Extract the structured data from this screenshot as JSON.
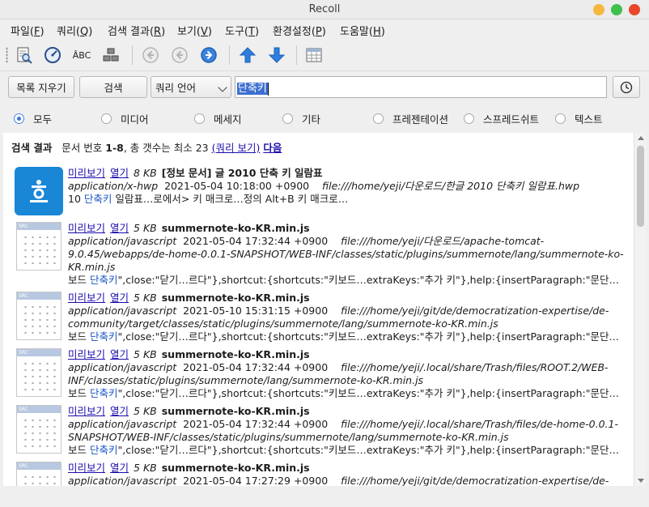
{
  "window": {
    "title": "Recoll"
  },
  "menu": [
    {
      "label": "파일(",
      "key": "F",
      "end": ")"
    },
    {
      "label": "쿼리(",
      "key": "Q",
      "end": ")"
    },
    {
      "label": "검색 결과(",
      "key": "R",
      "end": ")"
    },
    {
      "label": "보기(",
      "key": "V",
      "end": ")"
    },
    {
      "label": "도구(",
      "key": "T",
      "end": ")"
    },
    {
      "label": "환경설정(",
      "key": "P",
      "end": ")"
    },
    {
      "label": "도움말(",
      "key": "H",
      "end": ")"
    }
  ],
  "toolbar": {
    "spell_label": "ÂBC"
  },
  "search": {
    "clear_label": "목록 지우기",
    "search_label": "검색",
    "mode_value": "쿼리 언어",
    "query_value": "단축키"
  },
  "filters": [
    {
      "label": "모두",
      "checked": true
    },
    {
      "label": "미디어",
      "checked": false
    },
    {
      "label": "메세지",
      "checked": false
    },
    {
      "label": "기타",
      "checked": false
    },
    {
      "label": "프레젠테이션",
      "checked": false
    },
    {
      "label": "스프레드쉬트",
      "checked": false
    },
    {
      "label": "텍스트",
      "checked": false
    }
  ],
  "results_header": {
    "title": "검색 결과",
    "doc_prefix": "문서 번호",
    "range": "1-8",
    "total_text": ", 총 갯수는 최소 23",
    "show_query": "(쿼리 보기)",
    "next": "다음"
  },
  "result_links": {
    "preview": "미리보기",
    "open": "열기"
  },
  "results": [
    {
      "icon": "hwp-icon",
      "size": "8 KB",
      "title": "[정보 문서] 글 2010 단축 키 일람표",
      "mime": "application/x-hwp",
      "date": "2021-05-04 10:18:00 +0900",
      "url_lines": [
        "file:///home/yeji/다운로드/한글 2010 단축키 일람표.hwp"
      ],
      "abs_pre": "10 ",
      "abs_hl": "단축키",
      "abs_post": " 일람표…로에서> 키 매크로…정의 Alt+B 키 매크로…"
    },
    {
      "icon": "source-file-icon",
      "size": "5 KB",
      "title": "summernote-ko-KR.min.js",
      "mime": "application/javascript",
      "date": "2021-05-04 17:32:44 +0900",
      "url_lines": [
        "file:///home/yeji/다운로드/apache-tomcat-",
        "9.0.45/webapps/de-home-0.0.1-SNAPSHOT/WEB-INF/classes/static/plugins/summernote/lang/summernote-ko-",
        "KR.min.js"
      ],
      "abs_pre": "보드 ",
      "abs_hl": "단축키",
      "abs_post": "\",close:\"닫기…르다\"},shortcut:{shortcuts:\"키보드…extraKeys:\"추가 키\"},help:{insertParagraph:\"문단…"
    },
    {
      "icon": "source-file-icon",
      "size": "5 KB",
      "title": "summernote-ko-KR.min.js",
      "mime": "application/javascript",
      "date": "2021-05-10 15:31:15 +0900",
      "url_lines": [
        "file:///home/yeji/git/de/democratization-expertise/de-",
        "community/target/classes/static/plugins/summernote/lang/summernote-ko-KR.min.js"
      ],
      "abs_pre": "보드 ",
      "abs_hl": "단축키",
      "abs_post": "\",close:\"닫기…르다\"},shortcut:{shortcuts:\"키보드…extraKeys:\"추가 키\"},help:{insertParagraph:\"문단…"
    },
    {
      "icon": "source-file-icon",
      "size": "5 KB",
      "title": "summernote-ko-KR.min.js",
      "mime": "application/javascript",
      "date": "2021-05-04 17:32:44 +0900",
      "url_lines": [
        "file:///home/yeji/.local/share/Trash/files/ROOT.2/WEB-",
        "INF/classes/static/plugins/summernote/lang/summernote-ko-KR.min.js"
      ],
      "abs_pre": "보드 ",
      "abs_hl": "단축키",
      "abs_post": "\",close:\"닫기…르다\"},shortcut:{shortcuts:\"키보드…extraKeys:\"추가 키\"},help:{insertParagraph:\"문단…"
    },
    {
      "icon": "source-file-icon",
      "size": "5 KB",
      "title": "summernote-ko-KR.min.js",
      "mime": "application/javascript",
      "date": "2021-05-04 17:32:44 +0900",
      "url_lines": [
        "file:///home/yeji/.local/share/Trash/files/de-home-0.0.1-",
        "SNAPSHOT/WEB-INF/classes/static/plugins/summernote/lang/summernote-ko-KR.min.js"
      ],
      "abs_pre": "보드 ",
      "abs_hl": "단축키",
      "abs_post": "\",close:\"닫기…르다\"},shortcut:{shortcuts:\"키보드…extraKeys:\"추가 키\"},help:{insertParagraph:\"문단…"
    },
    {
      "icon": "source-file-icon",
      "size": "5 KB",
      "title": "summernote-ko-KR.min.js",
      "mime": "application/javascript",
      "date": "2021-05-04 17:27:29 +0900",
      "url_lines": [
        "file:///home/yeji/git/de/democratization-expertise/de-"
      ],
      "abs_pre": "",
      "abs_hl": "",
      "abs_post": ""
    }
  ]
}
